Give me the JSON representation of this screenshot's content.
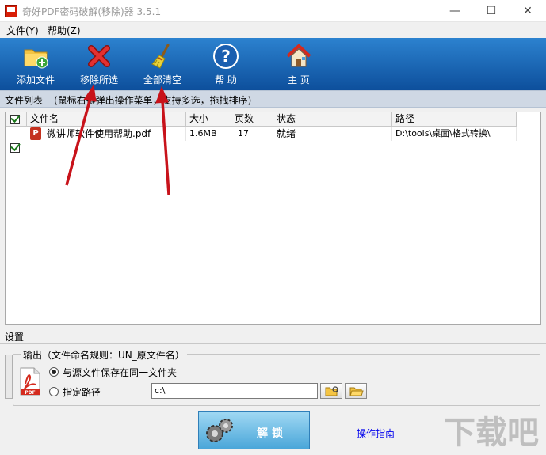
{
  "window": {
    "title": "奇好PDF密码破解(移除)器 3.5.1",
    "controls": {
      "minimize": "—",
      "maximize": "☐",
      "close": "✕"
    }
  },
  "menu": [
    {
      "label": "文件(Y)"
    },
    {
      "label": "帮助(Z)"
    }
  ],
  "toolbar": {
    "buttons": [
      {
        "label": "添加文件",
        "icon": "add-folder-icon"
      },
      {
        "label": "移除所选",
        "icon": "red-x-icon"
      },
      {
        "label": "全部清空",
        "icon": "broom-icon"
      },
      {
        "label": "帮 助",
        "icon": "help-question-icon"
      },
      {
        "label": "主 页",
        "icon": "home-icon"
      }
    ]
  },
  "filelist": {
    "title": "文件列表",
    "hint": "(鼠标右键弹出操作菜单，支持多选，拖拽排序)",
    "columns": [
      "文件名",
      "大小",
      "页数",
      "状态",
      "路径"
    ],
    "rows": [
      {
        "checked": true,
        "name": "微讲师软件使用帮助.pdf",
        "size": "1.6MB",
        "pages": "17",
        "status": "就绪",
        "path": "D:\\tools\\桌面\\格式转换\\"
      }
    ]
  },
  "settings": {
    "title": "设置",
    "output_label": "输出（文件命名规则：UN_原文件名）",
    "option_same_folder": "与源文件保存在同一文件夹",
    "option_custom_path": "指定路径",
    "custom_path_value": "c:\\",
    "selected_option": "same_folder"
  },
  "actions": {
    "unlock": "解 锁",
    "guide": "操作指南"
  },
  "colors": {
    "toolbar_top": "#2c82cf",
    "toolbar_bottom": "#0d4f9c",
    "annotation_arrow": "#c8121a",
    "unlock_button": "#4aa6d9"
  }
}
